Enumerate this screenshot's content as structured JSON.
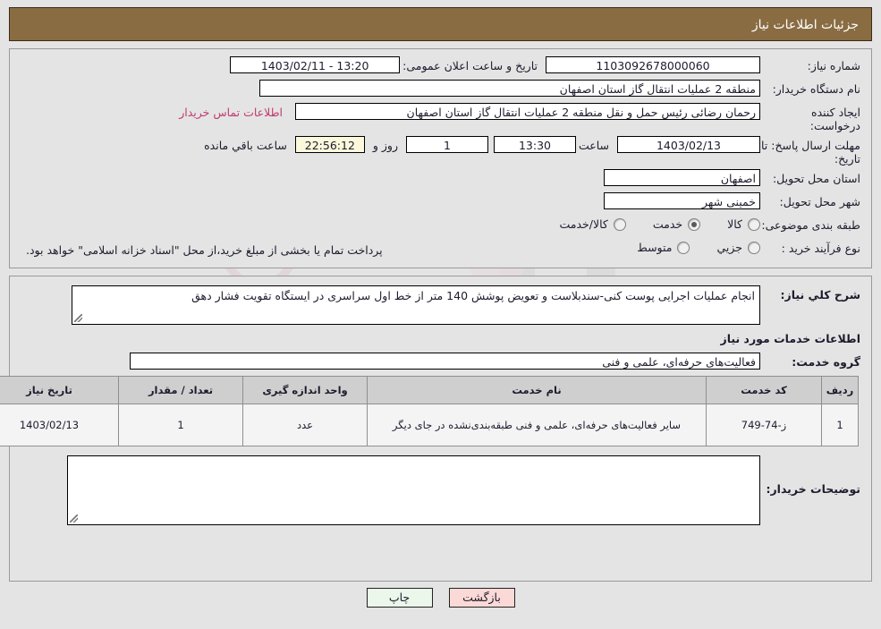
{
  "header": {
    "title": "جزئیات اطلاعات نیاز",
    "bar_color": "#8a6c43"
  },
  "top_form": {
    "need_number_label": "شماره نیاز:",
    "need_number_value": "1103092678000060",
    "announce_label": "تاریخ و ساعت اعلان عمومی:",
    "announce_value": "13:20 - 1403/02/11",
    "buyer_org_label": "نام دستگاه خریدار:",
    "buyer_org_value": "منطقه 2 عملیات انتقال گاز استان اصفهان",
    "creator_label": "ایجاد کننده درخواست:",
    "creator_value": "رحمان رضائی رئیس حمل و نقل منطقه 2 عملیات انتقال گاز استان اصفهان",
    "contact_link": "اطلاعات تماس خریدار",
    "deadline_label": "مهلت ارسال پاسخ: تا تاریخ:",
    "deadline_date": "1403/02/13",
    "deadline_hour_label": "ساعت",
    "deadline_time": "13:30",
    "remaining_days": "1",
    "days_and_label": "روز و",
    "countdown": "22:56:12",
    "countdown_suffix_label": "ساعت باقي مانده",
    "province_label": "استان محل تحویل:",
    "province_value": "اصفهان",
    "city_label": "شهر محل تحویل:",
    "city_value": "خمینی شهر",
    "category_label": "طبقه بندی موضوعی:",
    "category_options": [
      {
        "label": "کالا",
        "selected": false
      },
      {
        "label": "خدمت",
        "selected": true
      },
      {
        "label": "کالا/خدمت",
        "selected": false
      }
    ],
    "process_label": "نوع فرآیند خرید :",
    "process_options": [
      {
        "label": "جزیي",
        "selected": false
      },
      {
        "label": "متوسط",
        "selected": false
      }
    ],
    "payment_note": "پرداخت تمام یا بخشی از مبلغ خرید،از محل \"اسناد خزانه اسلامی\" خواهد بود."
  },
  "details": {
    "need_desc_label": "شرح کلي نیاز:",
    "need_desc_value": "انجام عملیات اجرایی پوست کنی-سندبلاست و تعویض پوشش 140 متر از خط اول سراسری در ایستگاه تقویت فشار دهق",
    "services_heading": "اطلاعات خدمات مورد نیاز",
    "service_group_label": "گروه خدمت:",
    "service_group_value": "فعالیت‌های حرفه‌ای، علمی و فنی",
    "comment_label": "توضیحات خریدار:",
    "comment_value": ""
  },
  "table": {
    "columns": [
      "ردیف",
      "کد خدمت",
      "نام خدمت",
      "واحد اندازه گیری",
      "تعداد / مقدار",
      "تاریخ نیاز"
    ],
    "rows": [
      {
        "radif": "1",
        "code": "ز-74-749",
        "name": "سایر فعالیت‌های حرفه‌ای، علمی و فنی طبقه‌بندی‌نشده در جای دیگر",
        "unit": "عدد",
        "qty": "1",
        "date": "1403/02/13"
      }
    ]
  },
  "buttons": {
    "print": "چاپ",
    "back": "بازگشت"
  },
  "watermark": {
    "text": "AriaTender.net"
  }
}
